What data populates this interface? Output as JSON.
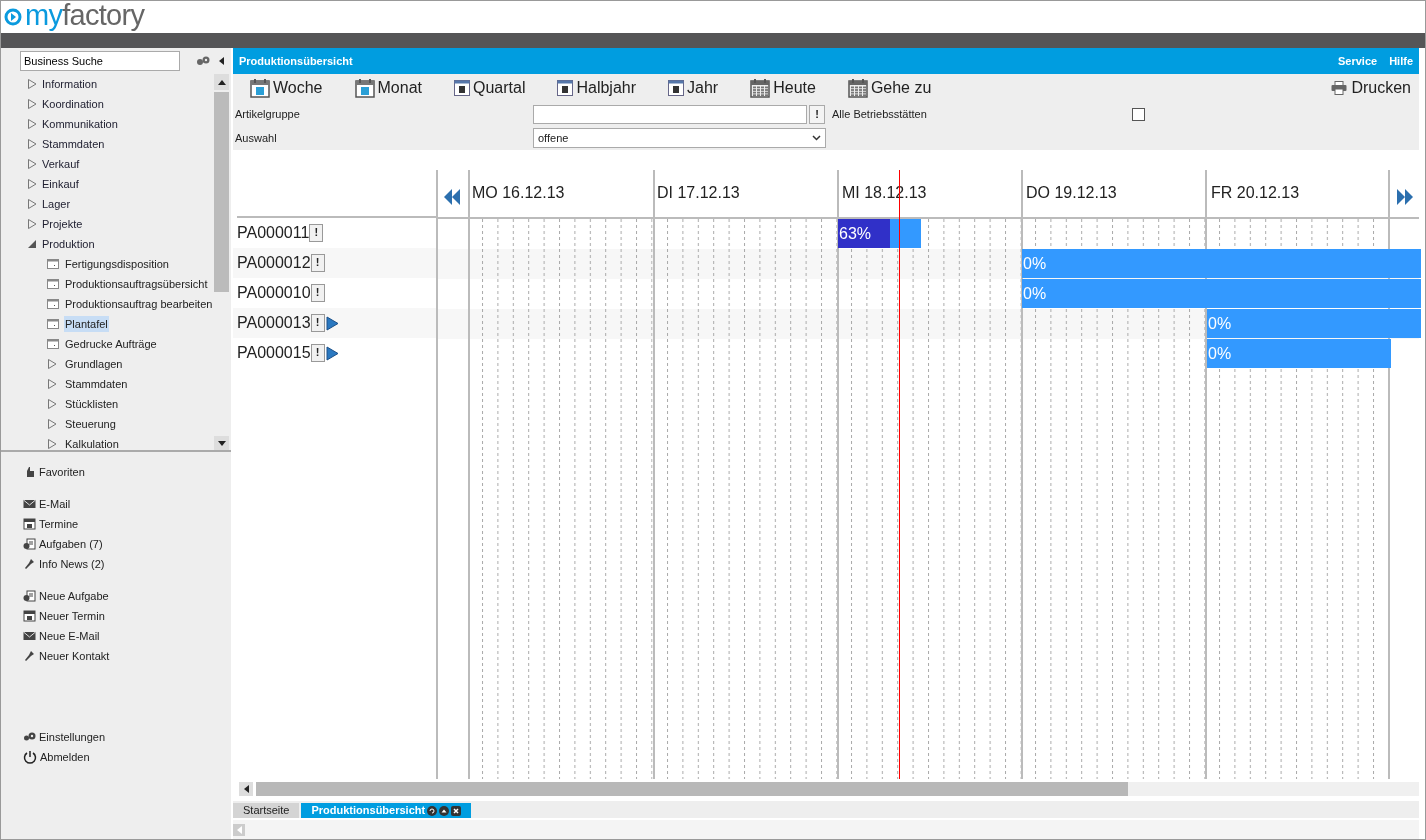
{
  "logo": {
    "prefix": "my",
    "name": "factory"
  },
  "sidebar": {
    "search": {
      "value": "Business Suche"
    },
    "tree": [
      {
        "label": "Information",
        "expanded": false,
        "selected": false
      },
      {
        "label": "Koordination",
        "expanded": false,
        "selected": false
      },
      {
        "label": "Kommunikation",
        "expanded": false,
        "selected": false
      },
      {
        "label": "Stammdaten",
        "expanded": false,
        "selected": false
      },
      {
        "label": "Verkauf",
        "expanded": false,
        "selected": false
      },
      {
        "label": "Einkauf",
        "expanded": false,
        "selected": false
      },
      {
        "label": "Lager",
        "expanded": false,
        "selected": false
      },
      {
        "label": "Projekte",
        "expanded": false,
        "selected": false
      },
      {
        "label": "Produktion",
        "expanded": true,
        "selected": false,
        "children": [
          {
            "label": "Fertigungsdisposition",
            "kind": "page",
            "selected": false
          },
          {
            "label": "Produktionsauftragsübersicht",
            "kind": "page",
            "selected": false
          },
          {
            "label": "Produktionsauftrag bearbeiten",
            "kind": "page",
            "selected": false
          },
          {
            "label": "Plantafel",
            "kind": "page",
            "selected": true
          },
          {
            "label": "Gedrucke Aufträge",
            "kind": "page",
            "selected": false
          },
          {
            "label": "Grundlagen",
            "kind": "folder",
            "expanded": false,
            "selected": false
          },
          {
            "label": "Stammdaten",
            "kind": "folder",
            "expanded": false,
            "selected": false
          },
          {
            "label": "Stücklisten",
            "kind": "folder",
            "expanded": false,
            "selected": false
          },
          {
            "label": "Steuerung",
            "kind": "folder",
            "expanded": false,
            "selected": false
          },
          {
            "label": "Kalkulation",
            "kind": "folder",
            "expanded": false,
            "selected": false
          }
        ]
      }
    ],
    "link_groups": [
      [
        {
          "label": "Favoriten",
          "kind": "favorites"
        }
      ],
      [
        {
          "label": "E-Mail",
          "kind": "mail"
        },
        {
          "label": "Termine",
          "kind": "calendar"
        },
        {
          "label": "Aufgaben (7)",
          "kind": "task"
        },
        {
          "label": "Info News (2)",
          "kind": "pin"
        }
      ],
      [
        {
          "label": "Neue Aufgabe",
          "kind": "task"
        },
        {
          "label": "Neuer Termin",
          "kind": "calendar"
        },
        {
          "label": "Neue E-Mail",
          "kind": "mail"
        },
        {
          "label": "Neuer Kontakt",
          "kind": "pin"
        }
      ],
      [
        {
          "label": "Einstellungen",
          "kind": "gears"
        },
        {
          "label": "Abmelden",
          "kind": "power"
        }
      ]
    ]
  },
  "main": {
    "title": "Produktionsübersicht",
    "header_links": [
      "Service",
      "Hilfe"
    ],
    "toolbar": [
      {
        "label": "Woche",
        "kind": "calendar"
      },
      {
        "label": "Monat",
        "kind": "calendar"
      },
      {
        "label": "Quartal",
        "kind": "calendar-small"
      },
      {
        "label": "Halbjahr",
        "kind": "calendar-small"
      },
      {
        "label": "Jahr",
        "kind": "calendar-small"
      },
      {
        "label": "Heute",
        "kind": "grid-calendar"
      },
      {
        "label": "Gehe zu",
        "kind": "grid-calendar"
      }
    ],
    "print": {
      "label": "Drucken"
    },
    "filters": {
      "artikelgruppe": {
        "label": "Artikelgruppe",
        "button": "!"
      },
      "betriebsstaetten": {
        "label": "Alle Betriebsstätten",
        "checked": false
      },
      "auswahl": {
        "label": "Auswahl",
        "value": "offene"
      }
    },
    "gantt": {
      "days": [
        "MO 16.12.13",
        "DI 17.12.13",
        "MI 18.12.13",
        "DO 19.12.13",
        "FR 20.12.13"
      ],
      "rows": [
        {
          "id": "PA000011",
          "flag": "!",
          "marker": false,
          "bar_label": "63%",
          "level": 0.63
        },
        {
          "id": "PA000012",
          "flag": "!",
          "marker": false,
          "bar_label": "0%"
        },
        {
          "id": "PA000010",
          "flag": "!",
          "marker": false,
          "bar_label": "0%"
        },
        {
          "id": "PA000013",
          "flag": "!",
          "marker": true,
          "bar_label": "0%"
        },
        {
          "id": "PA000015",
          "flag": "!",
          "marker": true,
          "bar_label": "0%"
        }
      ]
    },
    "tabs": [
      {
        "label": "Startseite",
        "selected": false
      },
      {
        "label": "Produktionsübersicht",
        "selected": true
      }
    ]
  }
}
